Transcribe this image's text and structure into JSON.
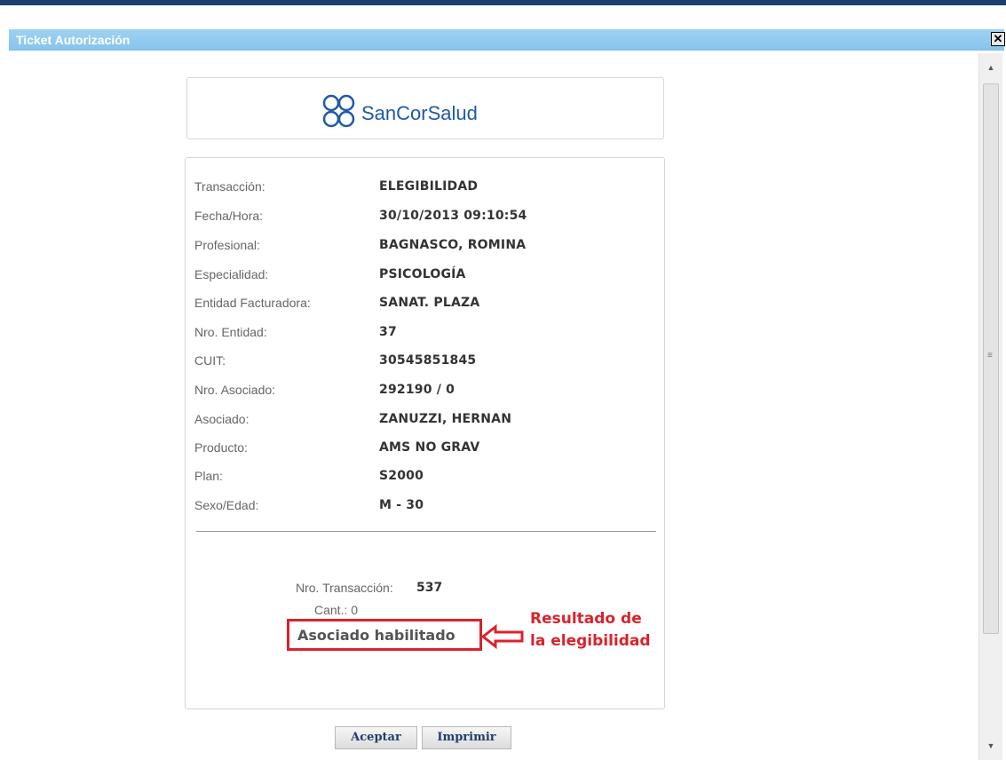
{
  "window": {
    "title": "Ticket Autorización",
    "close_label": "✕"
  },
  "logo": {
    "text": "SanCorSalud",
    "color": "#1f5aa6"
  },
  "fields": [
    {
      "label": "Transacción:",
      "value": "ELEGIBILIDAD"
    },
    {
      "label": "Fecha/Hora:",
      "value": "30/10/2013 09:10:54"
    },
    {
      "label": "Profesional:",
      "value": "BAGNASCO, ROMINA"
    },
    {
      "label": "Especialidad:",
      "value": "PSICOLOGÍA"
    },
    {
      "label": "Entidad Facturadora:",
      "value": "SANAT. PLAZA"
    },
    {
      "label": "Nro. Entidad:",
      "value": "37"
    },
    {
      "label": "CUIT:",
      "value": "30545851845"
    },
    {
      "label": "Nro. Asociado:",
      "value": "292190 / 0"
    },
    {
      "label": "Asociado:",
      "value": "ZANUZZI, HERNAN"
    },
    {
      "label": "Producto:",
      "value": "AMS NO GRAV"
    },
    {
      "label": "Plan:",
      "value": "S2000"
    },
    {
      "label": "Sexo/Edad:",
      "value": "M - 30"
    }
  ],
  "transaction": {
    "label": "Nro. Transacción:",
    "value": "537",
    "cant": "Cant.: 0"
  },
  "result": {
    "text": "Asociado habilitado"
  },
  "annotation": {
    "line1": "Resultado de",
    "line2": "la elegibilidad",
    "color": "#d9232d"
  },
  "buttons": {
    "accept": "Aceptar",
    "print": "Imprimir"
  }
}
